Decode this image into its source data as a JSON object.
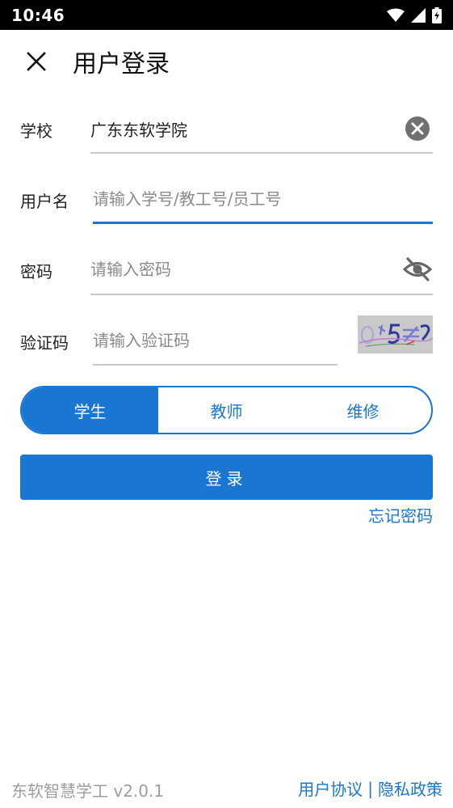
{
  "status_bar": {
    "time": "10:46"
  },
  "header": {
    "title": "用户登录",
    "close_icon": "close-icon"
  },
  "form": {
    "school": {
      "label": "学校",
      "value": "广东东软学院",
      "clear_icon": "clear-circle-icon"
    },
    "username": {
      "label": "用户名",
      "placeholder": "请输入学号/教工号/员工号"
    },
    "password": {
      "label": "密码",
      "placeholder": "请输入密码",
      "visibility_icon": "eye-off-icon"
    },
    "captcha": {
      "label": "验证码",
      "placeholder": "请输入验证码"
    }
  },
  "roles": {
    "items": [
      "学生",
      "教师",
      "维修"
    ],
    "selected": "学生"
  },
  "login_button": "登录",
  "forgot_password": "忘记密码",
  "footer": {
    "app_version": "东软智慧学工 v2.0.1",
    "user_agreement": "用户协议",
    "separator": "|",
    "privacy_policy": "隐私政策"
  },
  "colors": {
    "accent": "#1976d2",
    "status_bar": "#000000",
    "divider": "#c8c8c8",
    "placeholder": "#8a8a8a",
    "footer_text": "#9e9e9e"
  }
}
